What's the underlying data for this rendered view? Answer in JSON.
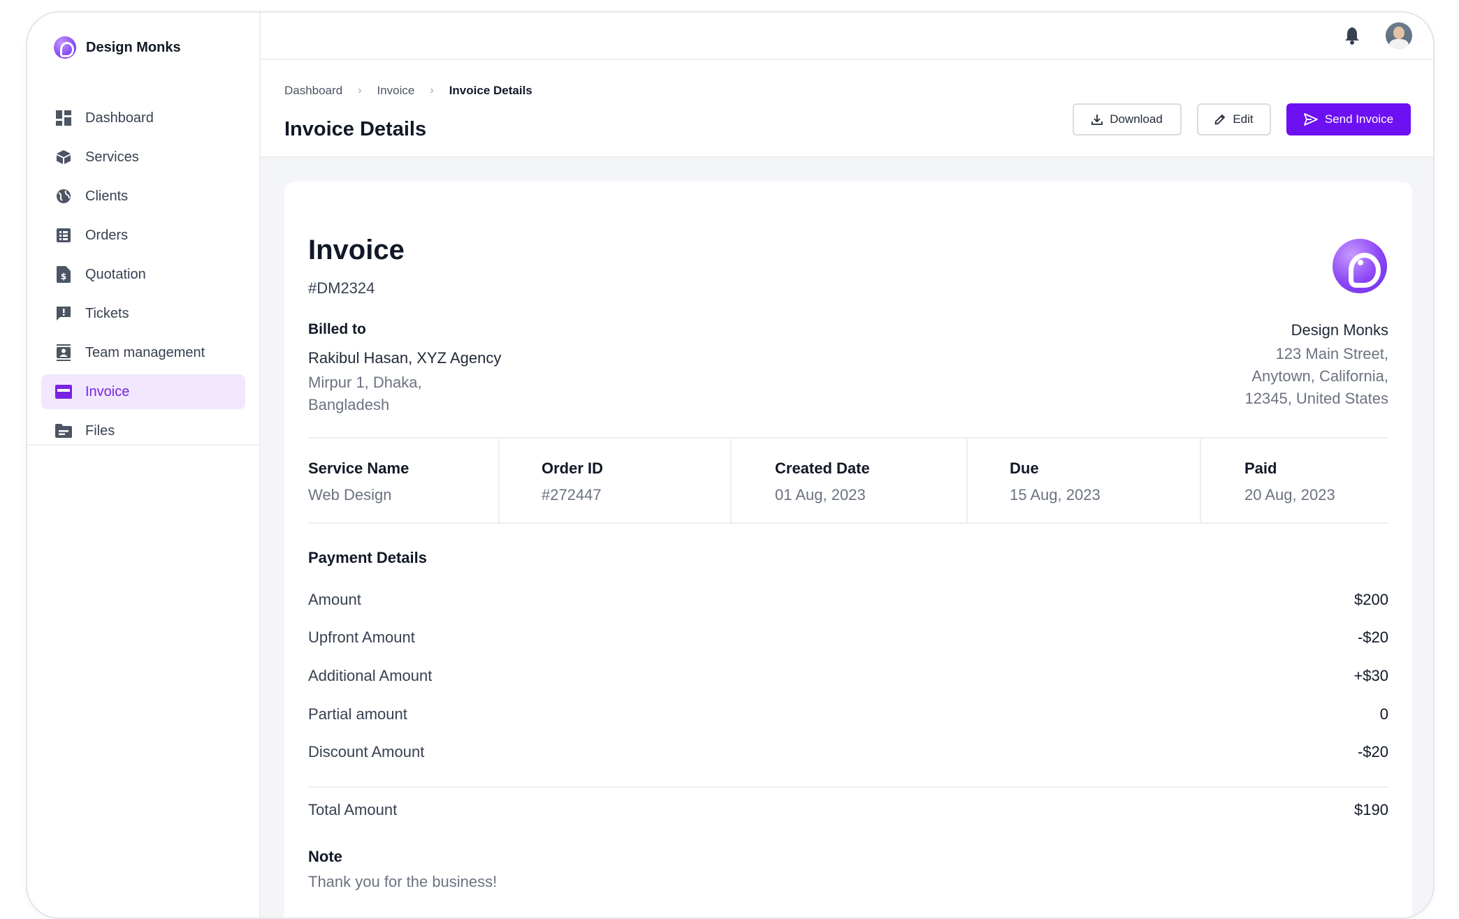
{
  "brand": {
    "name": "Design Monks"
  },
  "sidebar": {
    "items": [
      {
        "label": "Dashboard",
        "icon": "dashboard-icon"
      },
      {
        "label": "Services",
        "icon": "box-icon"
      },
      {
        "label": "Clients",
        "icon": "globe-icon"
      },
      {
        "label": "Orders",
        "icon": "list-icon"
      },
      {
        "label": "Quotation",
        "icon": "dollar-file-icon"
      },
      {
        "label": "Tickets",
        "icon": "message-alert-icon"
      },
      {
        "label": "Team management",
        "icon": "contact-card-icon"
      },
      {
        "label": "Invoice",
        "icon": "credit-card-icon",
        "active": true
      },
      {
        "label": "Files",
        "icon": "folder-icon"
      }
    ]
  },
  "breadcrumb": {
    "items": [
      "Dashboard",
      "Invoice",
      "Invoice Details"
    ]
  },
  "header": {
    "title": "Invoice Details",
    "download_label": "Download",
    "edit_label": "Edit",
    "send_label": "Send Invoice"
  },
  "invoice": {
    "title": "Invoice",
    "number": "#DM2324",
    "billed_to_label": "Billed to",
    "billed_name": "Rakibul Hasan, XYZ Agency",
    "billed_addr_line1": "Mirpur 1, Dhaka,",
    "billed_addr_line2": "Bangladesh",
    "from_name": "Design Monks",
    "from_addr_line1": "123 Main Street,",
    "from_addr_line2": "Anytown, California,",
    "from_addr_line3": "12345, United States"
  },
  "meta": {
    "service_label": "Service Name",
    "service_value": "Web Design",
    "order_label": "Order ID",
    "order_value": "#272447",
    "created_label": "Created Date",
    "created_value": "01 Aug, 2023",
    "due_label": "Due",
    "due_value": "15 Aug, 2023",
    "paid_label": "Paid",
    "paid_value": "20 Aug, 2023"
  },
  "payment": {
    "title": "Payment Details",
    "rows": [
      {
        "label": "Amount",
        "value": "$200"
      },
      {
        "label": "Upfront Amount",
        "value": "-$20"
      },
      {
        "label": "Additional Amount",
        "value": "+$30"
      },
      {
        "label": "Partial amount",
        "value": "0"
      },
      {
        "label": "Discount Amount",
        "value": "-$20"
      }
    ],
    "total_label": "Total Amount",
    "total_value": "$190"
  },
  "note": {
    "label": "Note",
    "text": "Thank you for the business!"
  },
  "colors": {
    "accent": "#6d10f2",
    "active_bg": "#f1e8ff",
    "active_text": "#7a22e3"
  }
}
